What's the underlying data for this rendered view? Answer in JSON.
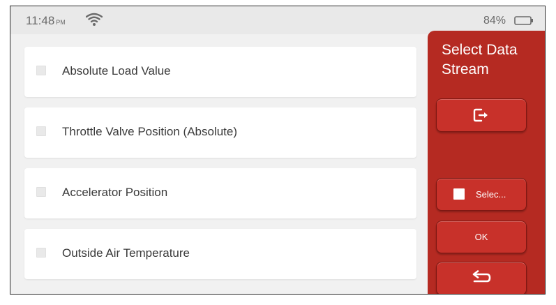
{
  "status_bar": {
    "time": "11:48",
    "ampm": "PM",
    "battery_percent": "84%",
    "icons": [
      "wifi-icon",
      "battery-icon"
    ]
  },
  "data_stream_list": {
    "items": [
      {
        "label": "Absolute Load Value",
        "checked": false
      },
      {
        "label": "Throttle Valve Position (Absolute)",
        "checked": false
      },
      {
        "label": "Accelerator Position",
        "checked": false
      },
      {
        "label": "Outside Air Temperature",
        "checked": false
      }
    ]
  },
  "sidebar": {
    "title": "Select Data Stream",
    "exit_icon": "exit-icon",
    "select_all_label": "Selec...",
    "ok_label": "OK",
    "back_icon": "back-arrow-icon"
  },
  "colors": {
    "sidebar_red": "#b52a22",
    "button_red": "#c8312a",
    "background": "#f1f1f1",
    "card": "#ffffff",
    "text": "#3a3a3a"
  }
}
